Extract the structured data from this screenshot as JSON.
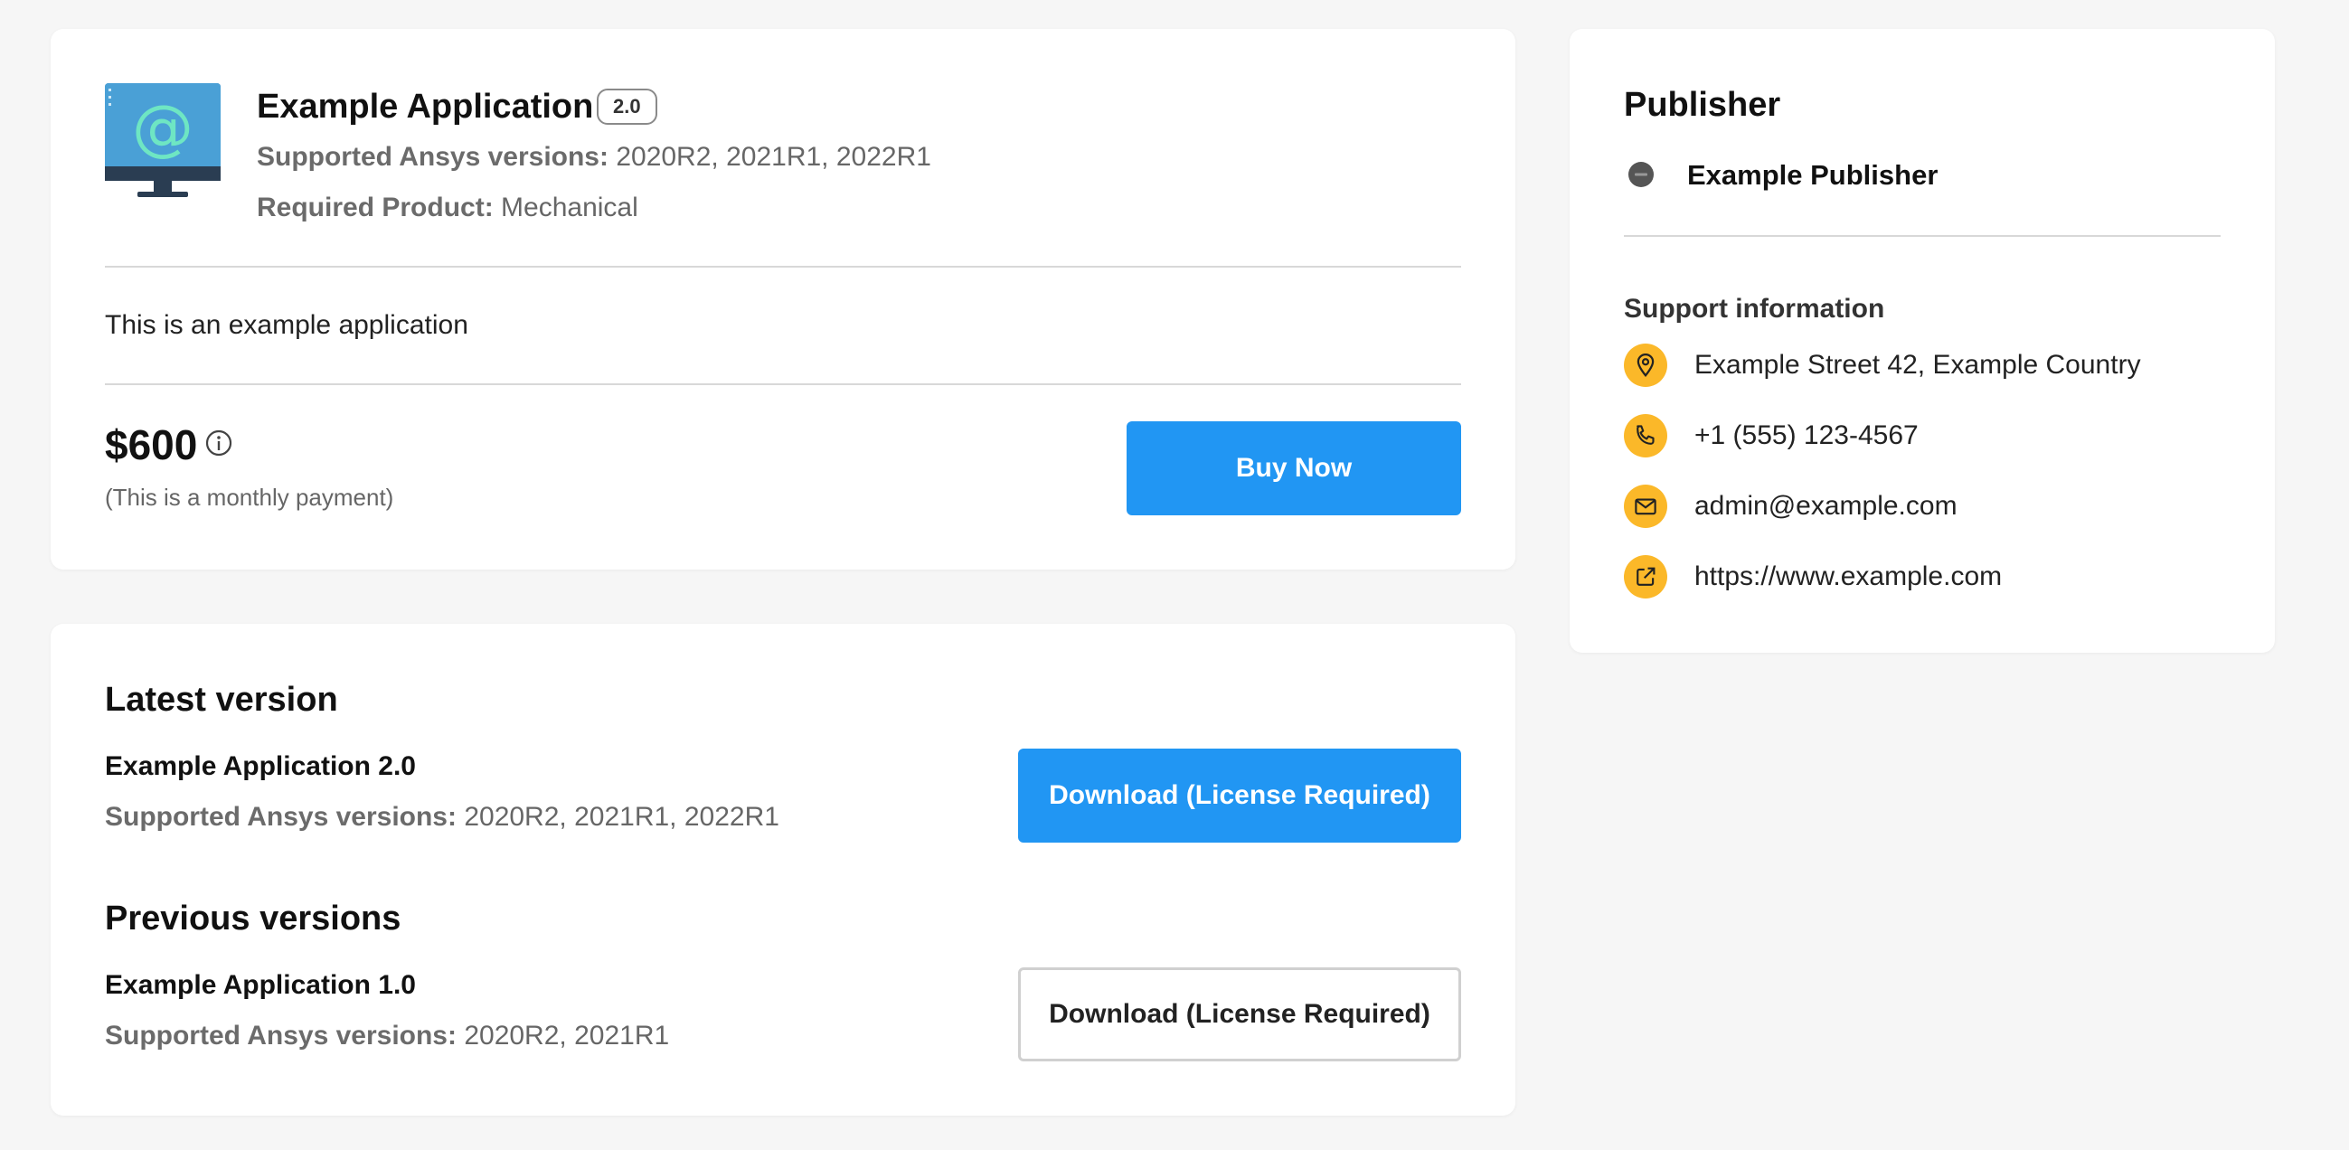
{
  "app": {
    "title": "Example Application",
    "version_badge": "2.0",
    "supported_label": "Supported Ansys versions:",
    "supported_value": " 2020R2, 2021R1, 2022R1",
    "required_label": "Required Product:",
    "required_value": " Mechanical",
    "description": "This is an example application",
    "price": "$600",
    "price_note": "(This is a monthly payment)",
    "buy_label": "Buy Now"
  },
  "versions": {
    "latest_heading": "Latest version",
    "latest": {
      "name": "Example Application 2.0",
      "supported_label": "Supported Ansys versions:",
      "supported_value": " 2020R2, 2021R1, 2022R1",
      "download_label": "Download (License Required)"
    },
    "previous_heading": "Previous versions",
    "previous": [
      {
        "name": "Example Application 1.0",
        "supported_label": "Supported Ansys versions:",
        "supported_value": " 2020R2, 2021R1",
        "download_label": "Download (License Required)"
      }
    ]
  },
  "publisher": {
    "heading": "Publisher",
    "name": "Example Publisher",
    "support_heading": "Support information",
    "contacts": [
      {
        "icon": "location-pin-icon",
        "text": "Example Street 42, Example Country"
      },
      {
        "icon": "phone-icon",
        "text": "+1 (555) 123-4567"
      },
      {
        "icon": "mail-icon",
        "text": "admin@example.com"
      },
      {
        "icon": "external-link-icon",
        "text": "https://www.example.com"
      }
    ]
  },
  "colors": {
    "primary": "#2196f3",
    "accent": "#fbb829",
    "background": "#f6f6f6"
  }
}
